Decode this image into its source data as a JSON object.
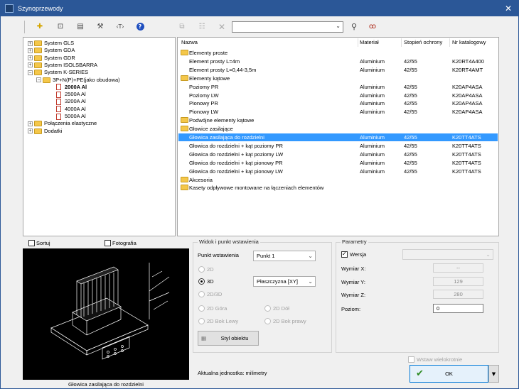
{
  "window": {
    "title": "Szynoprzewody",
    "close_icon": "close-icon"
  },
  "toolbar": {
    "icons": [
      "add-icon",
      "import-icon",
      "list-icon",
      "tools-icon",
      "text-icon",
      "help-icon",
      "copy-icon",
      "properties-icon",
      "delete-icon",
      "search-icon",
      "binoculars-icon"
    ],
    "search_value": ""
  },
  "tree": {
    "items": [
      {
        "label": "System GLS",
        "expander": "+"
      },
      {
        "label": "System GDA",
        "expander": "+"
      },
      {
        "label": "System GDR",
        "expander": "+"
      },
      {
        "label": "System ISOLSBARRA",
        "expander": "+"
      },
      {
        "label": "System K-SERIES",
        "expander": "-"
      },
      {
        "label": "3P+N(P)+PE(jako obudowa)",
        "expander": "-"
      },
      {
        "label": "2000A Al"
      },
      {
        "label": "2500A Al"
      },
      {
        "label": "3200A Al"
      },
      {
        "label": "4000A Al"
      },
      {
        "label": "5000A Al"
      },
      {
        "label": "Połączenia elastyczne",
        "expander": "+"
      },
      {
        "label": "Dodatki",
        "expander": "+"
      }
    ]
  },
  "list": {
    "columns": [
      "Nazwa",
      "Materiał",
      "Stopień ochrony",
      "Nr katalogowy"
    ],
    "rows": [
      {
        "name": "Elementy proste",
        "folder": true
      },
      {
        "name": "Element prosty L=4m",
        "material": "Aluminium",
        "ip": "42/55",
        "cat": "K20RT4A400"
      },
      {
        "name": "Element prosty L=0,44-3,5m",
        "material": "Aluminium",
        "ip": "42/55",
        "cat": "K20RT4AMT"
      },
      {
        "name": "Elementy kątowe",
        "folder": true
      },
      {
        "name": "Poziomy PR",
        "material": "Aluminium",
        "ip": "42/55",
        "cat": "K20AP4ASA"
      },
      {
        "name": "Poziomy LW",
        "material": "Aluminium",
        "ip": "42/55",
        "cat": "K20AP4ASA"
      },
      {
        "name": "Pionowy PR",
        "material": "Aluminium",
        "ip": "42/55",
        "cat": "K20AP4ASA"
      },
      {
        "name": "Pionowy LW",
        "material": "Aluminium",
        "ip": "42/55",
        "cat": "K20AP4ASA"
      },
      {
        "name": "Podwójne elementy kątowe",
        "folder": true
      },
      {
        "name": "Głowice zasilające",
        "folder": true
      },
      {
        "name": "Głowica zasilająca do rozdzielni",
        "material": "Aluminium",
        "ip": "42/55",
        "cat": "K20TT4ATS",
        "selected": true
      },
      {
        "name": "Głowica do rozdzielni + kąt poziomy PR",
        "material": "Aluminium",
        "ip": "42/55",
        "cat": "K20TT4ATS"
      },
      {
        "name": "Głowica do rozdzielni + kąt poziomy LW",
        "material": "Aluminium",
        "ip": "42/55",
        "cat": "K20TT4ATS"
      },
      {
        "name": "Głowica do rozdzielni + kąt pionowy PR",
        "material": "Aluminium",
        "ip": "42/55",
        "cat": "K20TT4ATS"
      },
      {
        "name": "Głowica do rozdzielni + kąt pionowy LW",
        "material": "Aluminium",
        "ip": "42/55",
        "cat": "K20TT4ATS"
      },
      {
        "name": "Akcesoria",
        "folder": true
      },
      {
        "name": "Kasety odpływowe montowane na łączeniach elementów",
        "folder": true
      }
    ]
  },
  "preview": {
    "sort_label": "Sortuj",
    "photo_label": "Fotografia",
    "caption": "Głowica zasilająca do rozdzielni"
  },
  "view": {
    "group_title": "Widok i punkt wstawienia",
    "insert_point_label": "Punkt wstawienia",
    "insert_point_value": "Punkt 1",
    "plane_value": "Płaszczyzna [XY]",
    "radios": {
      "r2d": "2D",
      "r3d": "3D",
      "r2d3d": "2D/3D",
      "top": "2D Góra",
      "bottom": "2D Dół",
      "left": "2D Bok Lewy",
      "right": "2D Bok prawy"
    },
    "style_button": "Styl obiektu"
  },
  "params": {
    "group_title": "Parametry",
    "version_label": "Wersja",
    "dim_x_label": "Wymiar X:",
    "dim_x_value": "--",
    "dim_y_label": "Wymiar Y:",
    "dim_y_value": "129",
    "dim_z_label": "Wymiar Z:",
    "dim_z_value": "280",
    "level_label": "Poziom:",
    "level_value": "0"
  },
  "footer": {
    "unit_text": "Aktualna jednostka: milimetry",
    "multi_insert": "Wstaw wielokrotnie",
    "ok": "OK"
  }
}
